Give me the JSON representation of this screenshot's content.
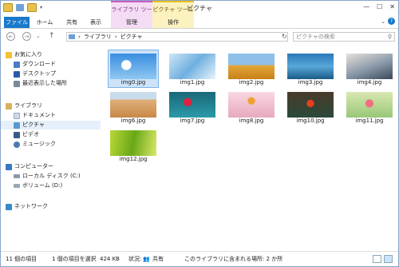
{
  "window": {
    "title": "ピクチャ",
    "min": "—",
    "max": "☐",
    "close": "✕"
  },
  "context_tabs": {
    "library": "ライブラリ ツール",
    "picture": "ピクチャ ツール"
  },
  "ribbon": {
    "file": "ファイル",
    "home": "ホーム",
    "share": "共有",
    "view": "表示",
    "manage": "管理",
    "operate": "操作"
  },
  "address": {
    "path1": "ライブラリ",
    "path2": "ピクチャ",
    "sep": "›"
  },
  "search": {
    "placeholder": "ピクチャの検索"
  },
  "nav": {
    "favorites": "お気に入り",
    "downloads": "ダウンロード",
    "desktop": "デスクトップ",
    "recent": "最近表示した場所",
    "libraries": "ライブラリ",
    "documents": "ドキュメント",
    "pictures": "ピクチャ",
    "videos": "ビデオ",
    "music": "ミュージック",
    "computer": "コンピューター",
    "local_disk": "ローカル ディスク (C:)",
    "volume": "ボリューム (D:)",
    "network": "ネットワーク"
  },
  "files": [
    {
      "name": "img0.jpg"
    },
    {
      "name": "img1.jpg"
    },
    {
      "name": "img2.jpg"
    },
    {
      "name": "img3.jpg"
    },
    {
      "name": "img4.jpg"
    },
    {
      "name": "img6.jpg"
    },
    {
      "name": "img7.jpg"
    },
    {
      "name": "img8.jpg"
    },
    {
      "name": "img10.jpg"
    },
    {
      "name": "img11.jpg"
    },
    {
      "name": "img12.jpg"
    }
  ],
  "status": {
    "count": "11 個の項目",
    "selected": "1 個の項目を選択",
    "size": "424 KB",
    "state_label": "状況:",
    "state_value": "共有",
    "library_info": "このライブラリに含まれる場所: 2 か所"
  },
  "colors": {
    "file_tab": "#1979ca",
    "selection": "#cde3f8",
    "library_ctx": "#f5dcf5",
    "picture_ctx": "#fbf2c0"
  }
}
